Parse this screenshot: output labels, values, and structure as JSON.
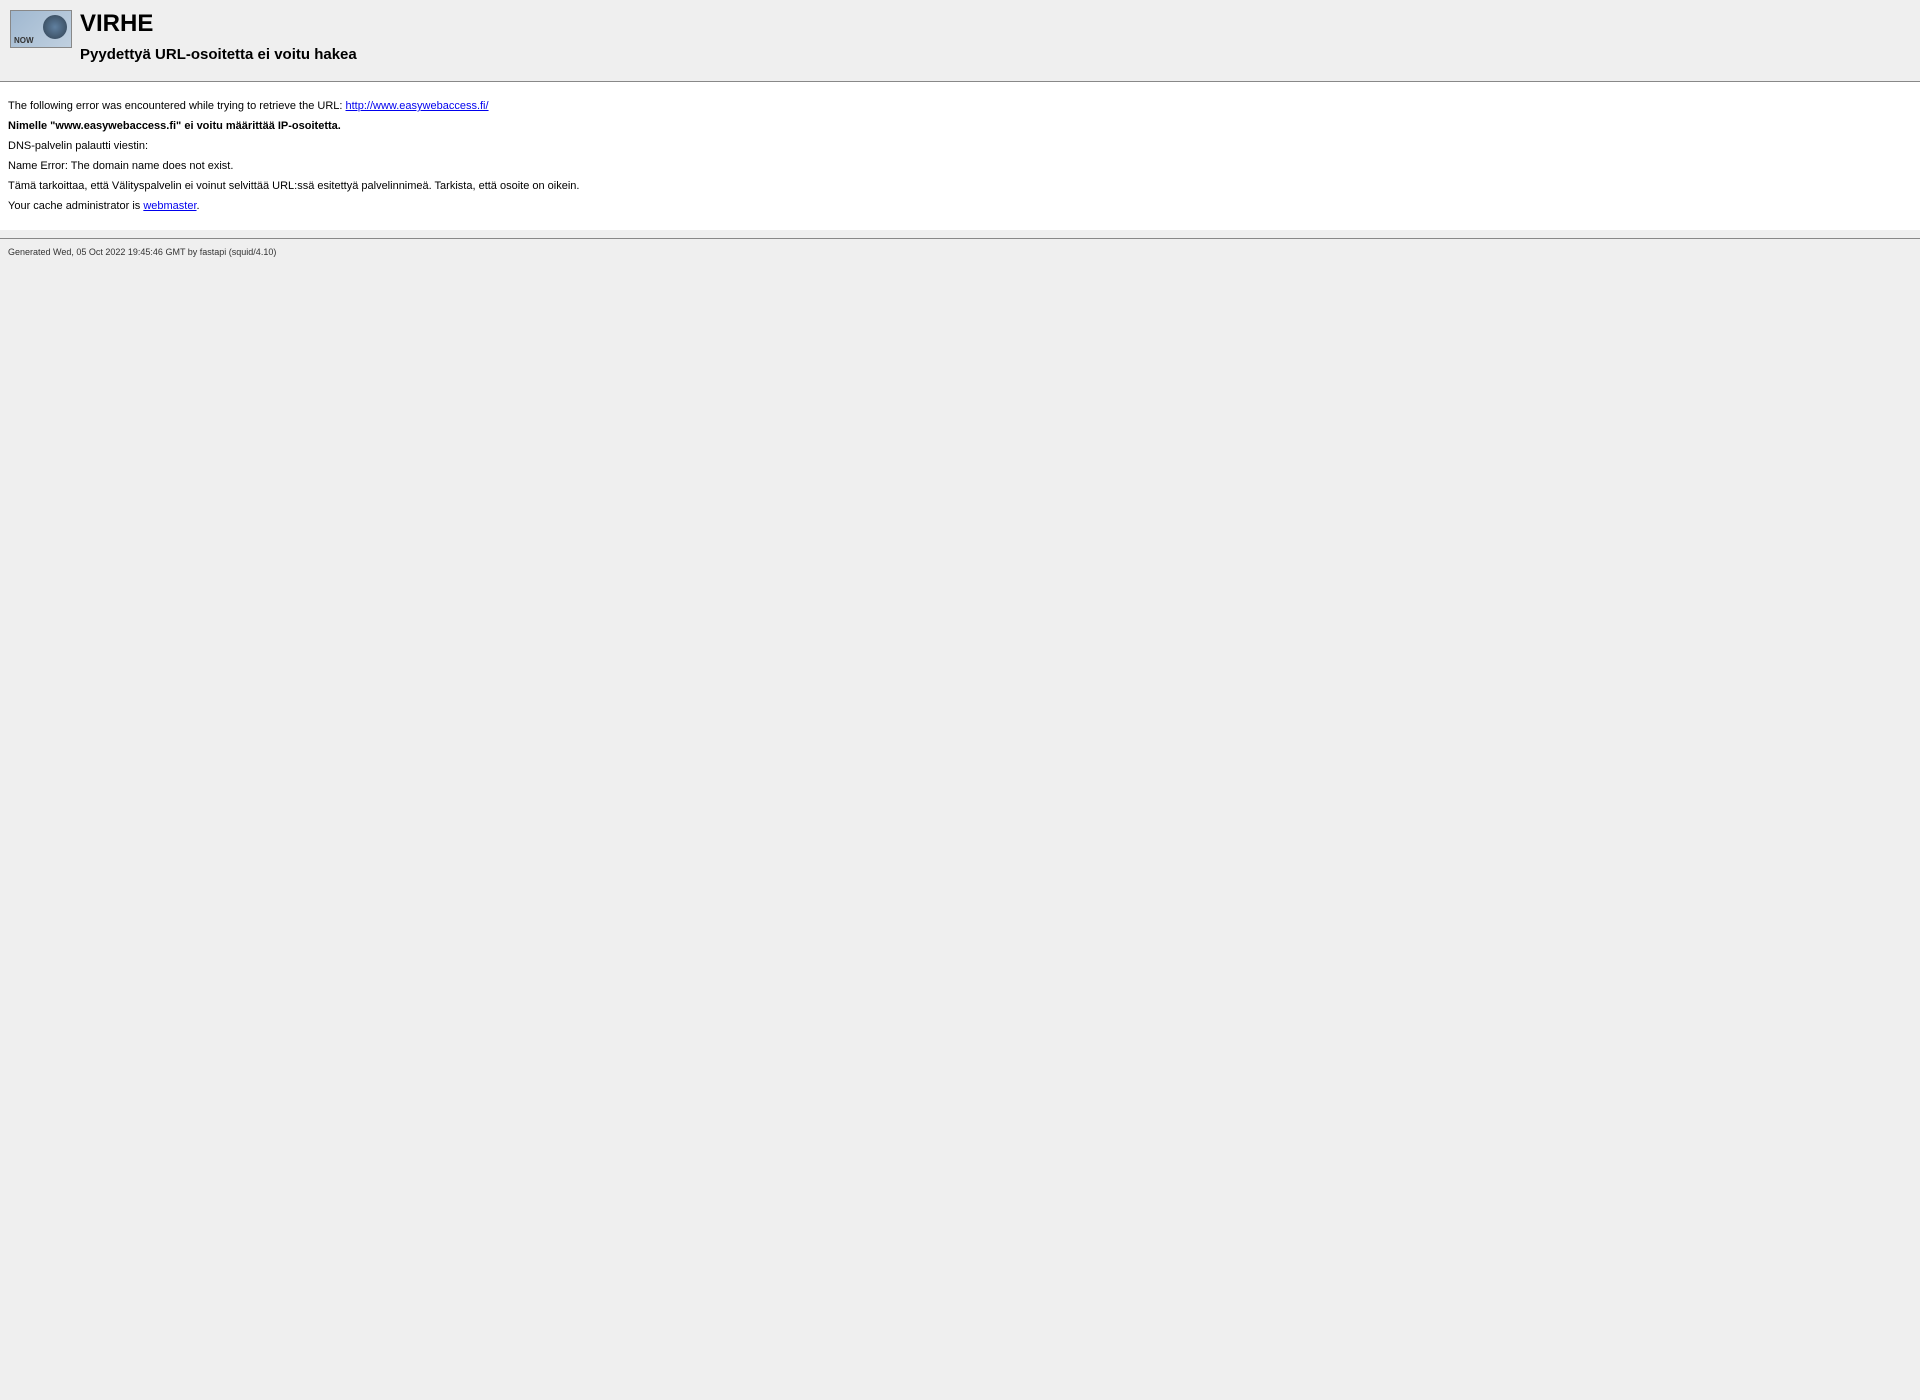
{
  "header": {
    "title": "VIRHE",
    "subtitle": "Pyydettyä URL-osoitetta ei voitu hakea",
    "logo_text": "NOW"
  },
  "content": {
    "intro": "The following error was encountered while trying to retrieve the URL: ",
    "url": "http://www.easywebaccess.fi/",
    "dns_error": "Nimelle \"www.easywebaccess.fi\" ei voitu määrittää IP-osoitetta.",
    "dns_message": "DNS-palvelin palautti viestin:",
    "name_error": "Name Error: The domain name does not exist.",
    "explanation": "Tämä tarkoittaa, että Välityspalvelin ei voinut selvittää URL:ssä esitettyä palvelinnimeä. Tarkista, että osoite on oikein.",
    "admin_intro": "Your cache administrator is ",
    "admin_link": "webmaster",
    "admin_period": "."
  },
  "footer": {
    "generated": "Generated Wed, 05 Oct 2022 19:45:46 GMT by fastapi (squid/4.10)"
  }
}
